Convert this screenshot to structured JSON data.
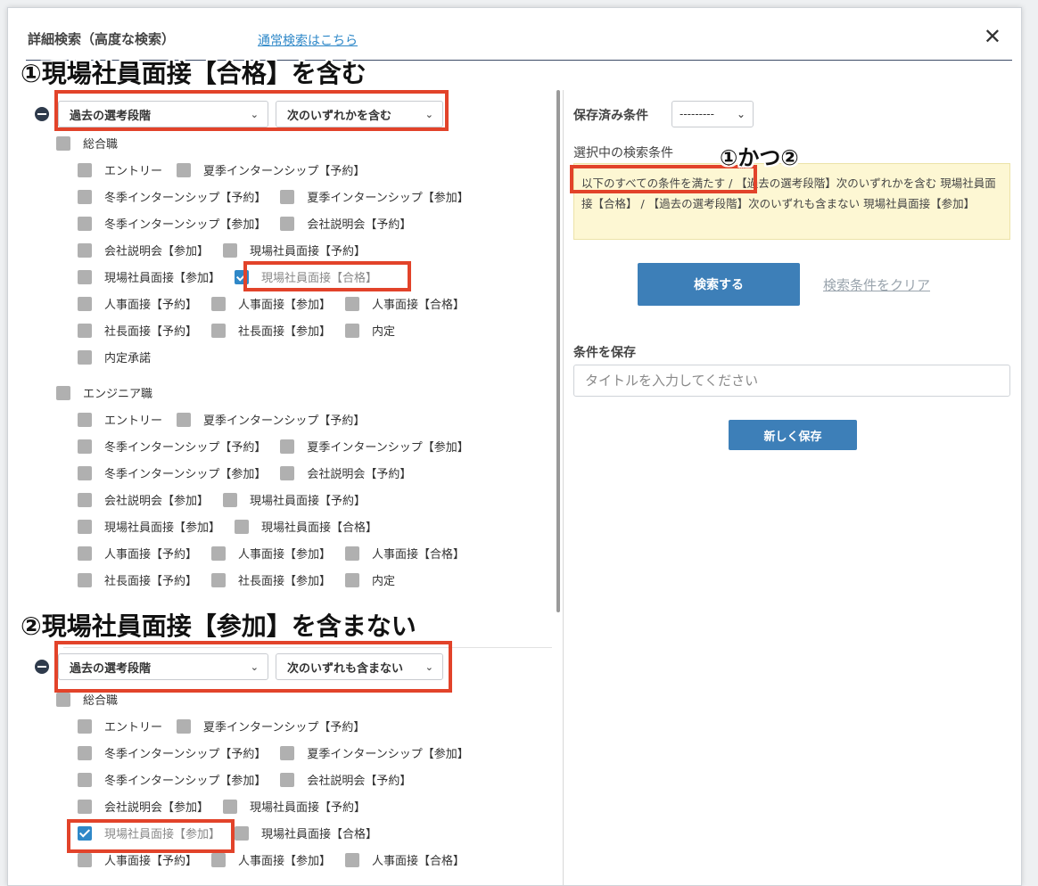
{
  "header": {
    "title": "詳細検索（高度な検索）",
    "normal_search_link": "通常検索はこちら"
  },
  "annotations": {
    "first": "①現場社員面接【合格】を含む",
    "second": "②現場社員面接【参加】を含まない",
    "combo": "①かつ②"
  },
  "groups": [
    {
      "field": "過去の選考段階",
      "operator": "次のいずれかを含む",
      "categories": [
        {
          "name": "総合職",
          "rows": [
            [
              {
                "label": "エントリー",
                "checked": false
              },
              {
                "label": "夏季インターンシップ【予約】",
                "checked": false
              }
            ],
            [
              {
                "label": "冬季インターンシップ【予約】",
                "checked": false
              },
              {
                "label": "夏季インターンシップ【参加】",
                "checked": false
              }
            ],
            [
              {
                "label": "冬季インターンシップ【参加】",
                "checked": false
              },
              {
                "label": "会社説明会【予約】",
                "checked": false
              }
            ],
            [
              {
                "label": "会社説明会【参加】",
                "checked": false
              },
              {
                "label": "現場社員面接【予約】",
                "checked": false
              }
            ],
            [
              {
                "label": "現場社員面接【参加】",
                "checked": false
              },
              {
                "label": "現場社員面接【合格】",
                "checked": true
              }
            ],
            [
              {
                "label": "人事面接【予約】",
                "checked": false
              },
              {
                "label": "人事面接【参加】",
                "checked": false
              },
              {
                "label": "人事面接【合格】",
                "checked": false
              }
            ],
            [
              {
                "label": "社長面接【予約】",
                "checked": false
              },
              {
                "label": "社長面接【参加】",
                "checked": false
              },
              {
                "label": "内定",
                "checked": false
              }
            ],
            [
              {
                "label": "内定承諾",
                "checked": false
              }
            ]
          ]
        },
        {
          "name": "エンジニア職",
          "rows": [
            [
              {
                "label": "エントリー",
                "checked": false
              },
              {
                "label": "夏季インターンシップ【予約】",
                "checked": false
              }
            ],
            [
              {
                "label": "冬季インターンシップ【予約】",
                "checked": false
              },
              {
                "label": "夏季インターンシップ【参加】",
                "checked": false
              }
            ],
            [
              {
                "label": "冬季インターンシップ【参加】",
                "checked": false
              },
              {
                "label": "会社説明会【予約】",
                "checked": false
              }
            ],
            [
              {
                "label": "会社説明会【参加】",
                "checked": false
              },
              {
                "label": "現場社員面接【予約】",
                "checked": false
              }
            ],
            [
              {
                "label": "現場社員面接【参加】",
                "checked": false
              },
              {
                "label": "現場社員面接【合格】",
                "checked": false
              }
            ],
            [
              {
                "label": "人事面接【予約】",
                "checked": false
              },
              {
                "label": "人事面接【参加】",
                "checked": false
              },
              {
                "label": "人事面接【合格】",
                "checked": false
              }
            ],
            [
              {
                "label": "社長面接【予約】",
                "checked": false
              },
              {
                "label": "社長面接【参加】",
                "checked": false
              },
              {
                "label": "内定",
                "checked": false
              }
            ]
          ]
        }
      ]
    },
    {
      "field": "過去の選考段階",
      "operator": "次のいずれも含まない",
      "categories": [
        {
          "name": "総合職",
          "rows": [
            [
              {
                "label": "エントリー",
                "checked": false
              },
              {
                "label": "夏季インターンシップ【予約】",
                "checked": false
              }
            ],
            [
              {
                "label": "冬季インターンシップ【予約】",
                "checked": false
              },
              {
                "label": "夏季インターンシップ【参加】",
                "checked": false
              }
            ],
            [
              {
                "label": "冬季インターンシップ【参加】",
                "checked": false
              },
              {
                "label": "会社説明会【予約】",
                "checked": false
              }
            ],
            [
              {
                "label": "会社説明会【参加】",
                "checked": false
              },
              {
                "label": "現場社員面接【予約】",
                "checked": false
              }
            ],
            [
              {
                "label": "現場社員面接【参加】",
                "checked": true
              },
              {
                "label": "現場社員面接【合格】",
                "checked": false
              }
            ],
            [
              {
                "label": "人事面接【予約】",
                "checked": false
              },
              {
                "label": "人事面接【参加】",
                "checked": false
              },
              {
                "label": "人事面接【合格】",
                "checked": false
              }
            ]
          ]
        }
      ]
    }
  ],
  "right": {
    "saved_label": "保存済み条件",
    "saved_value": "---------",
    "selected_label": "選択中の検索条件",
    "condition_prefix": "以下のすべての条件を満たす",
    "condition_rest": " / 【過去の選考段階】次のいずれかを含む 現場社員面接【合格】 / 【過去の選考段階】次のいずれも含まない 現場社員面接【参加】",
    "search_button": "検索する",
    "clear_link": "検索条件をクリア",
    "save_section_label": "条件を保存",
    "title_placeholder": "タイトルを入力してください",
    "save_button": "新しく保存"
  },
  "colors": {
    "accent": "#2f88c8",
    "button": "#3d7fb8",
    "highlight": "#e2432a",
    "condition_bg": "#fdf7d3"
  }
}
